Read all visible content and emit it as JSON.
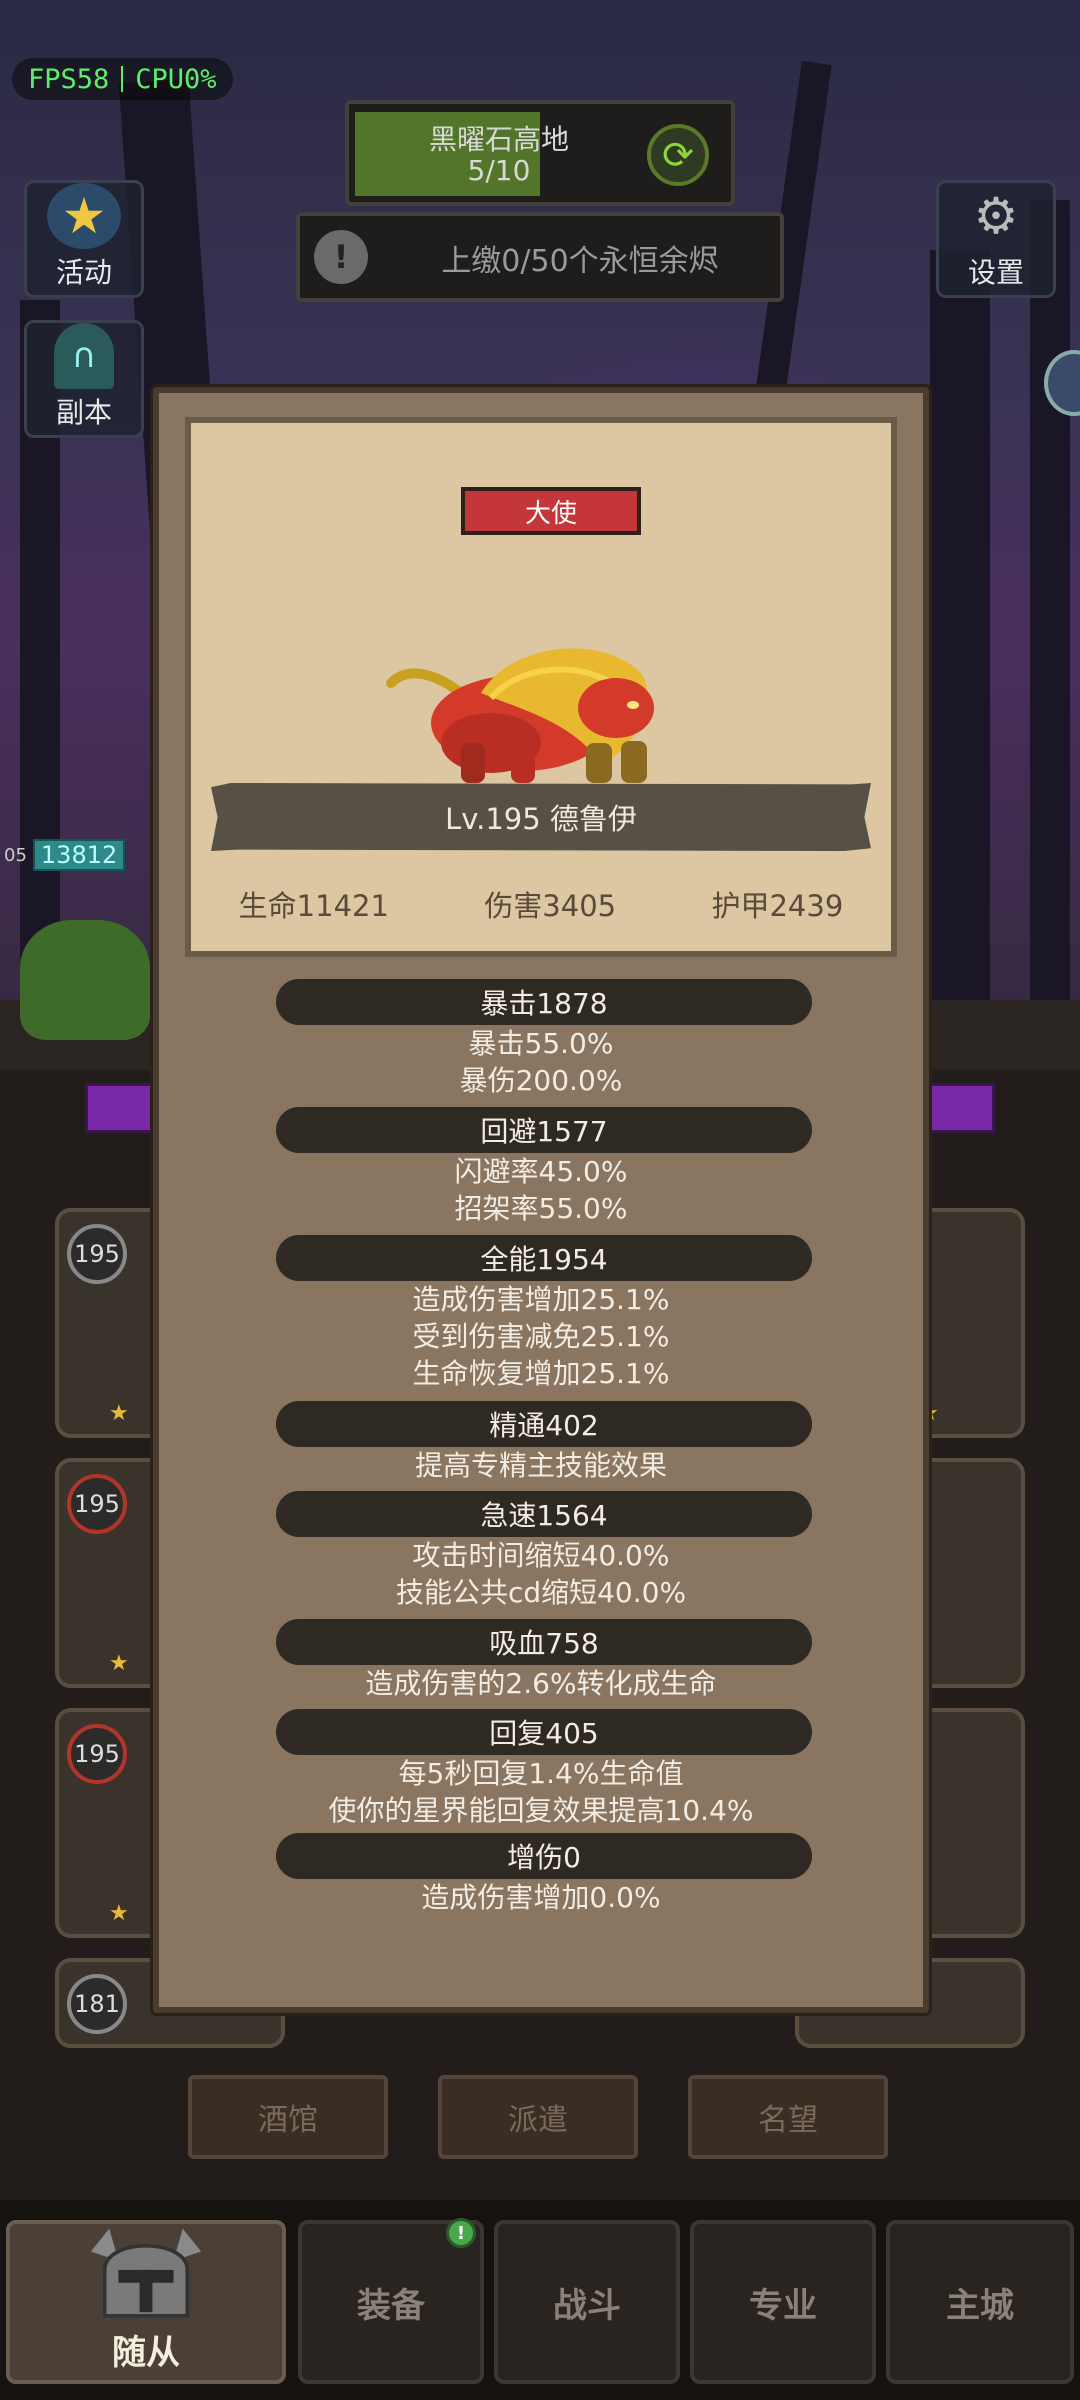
{
  "hud": {
    "fps": "FPS58",
    "cpu": "CPU0%",
    "level_name": "黑曜石高地",
    "level_progress": "5/10",
    "level_progress_fraction": 0.5,
    "quest_text": "上缴0/50个永恒余烬",
    "activity_label": "活动",
    "dungeon_label": "副本",
    "settings_label": "设置",
    "hp_tag_prefix": "05",
    "hp_tag_value": "13812"
  },
  "modal": {
    "type_badge": "大使",
    "name": "Lv.195 德鲁伊",
    "base_stats": {
      "hp": "生命11421",
      "damage": "伤害3405",
      "armor": "护甲2439"
    },
    "stats": [
      {
        "header": "暴击1878",
        "lines": [
          "暴击55.0%",
          "暴伤200.0%"
        ]
      },
      {
        "header": "回避1577",
        "lines": [
          "闪避率45.0%",
          "招架率55.0%"
        ]
      },
      {
        "header": "全能1954",
        "lines": [
          "造成伤害增加25.1%",
          "受到伤害减免25.1%",
          "生命恢复增加25.1%"
        ]
      },
      {
        "header": "精通402",
        "lines": [
          "提高专精主技能效果"
        ]
      },
      {
        "header": "急速1564",
        "lines": [
          "攻击时间缩短40.0%",
          "技能公共cd缩短40.0%"
        ]
      },
      {
        "header": "吸血758",
        "lines": [
          "造成伤害的2.6%转化成生命"
        ]
      },
      {
        "header": "回复405",
        "lines": [
          "每5秒回复1.4%生命值",
          "使你的星界能回复效果提高10.4%"
        ]
      },
      {
        "header": "增伤0",
        "lines": [
          "造成伤害增加0.0%"
        ]
      }
    ]
  },
  "hero_cards": {
    "levels": [
      "195",
      "195",
      "195",
      "181"
    ]
  },
  "tabs": {
    "tavern": "酒馆",
    "dispatch": "派遣",
    "reputation": "名望"
  },
  "nav": {
    "followers": "随从",
    "equipment": "装备",
    "battle": "战斗",
    "profession": "专业",
    "main_city": "主城",
    "equipment_badge": "!"
  },
  "colors": {
    "modal_bg": "#8a7560",
    "card_bg": "#dcc7a2",
    "badge_red": "#c4363a",
    "fps_green": "#5cf06a"
  }
}
